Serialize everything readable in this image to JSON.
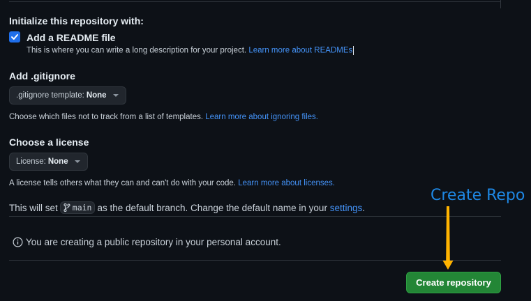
{
  "init": {
    "heading": "Initialize this repository with:",
    "readme_label": "Add a README file",
    "readme_desc": "This is where you can write a long description for your project.",
    "readme_link": "Learn more about READMEs"
  },
  "gitignore": {
    "heading": "Add .gitignore",
    "dropdown_label": ".gitignore template:",
    "dropdown_value": "None",
    "desc": "Choose which files not to track from a list of templates.",
    "link": "Learn more about ignoring files."
  },
  "license": {
    "heading": "Choose a license",
    "dropdown_label": "License:",
    "dropdown_value": "None",
    "desc": "A license tells others what they can and can't do with your code.",
    "link": "Learn more about licenses."
  },
  "branch": {
    "prefix": "This will set",
    "name": "main",
    "suffix": "as the default branch. Change the default name in your",
    "settings_link": "settings",
    "period": "."
  },
  "notice": {
    "text": "You are creating a public repository in your personal account."
  },
  "actions": {
    "create_label": "Create repository"
  },
  "annotation": {
    "text": "Create Repo",
    "color": "#1e88e5",
    "arrow_color": "#ffb300"
  },
  "colors": {
    "background": "#0d1117",
    "link": "#4493f8",
    "primary_button": "#238636",
    "checkbox": "#1f6feb"
  }
}
